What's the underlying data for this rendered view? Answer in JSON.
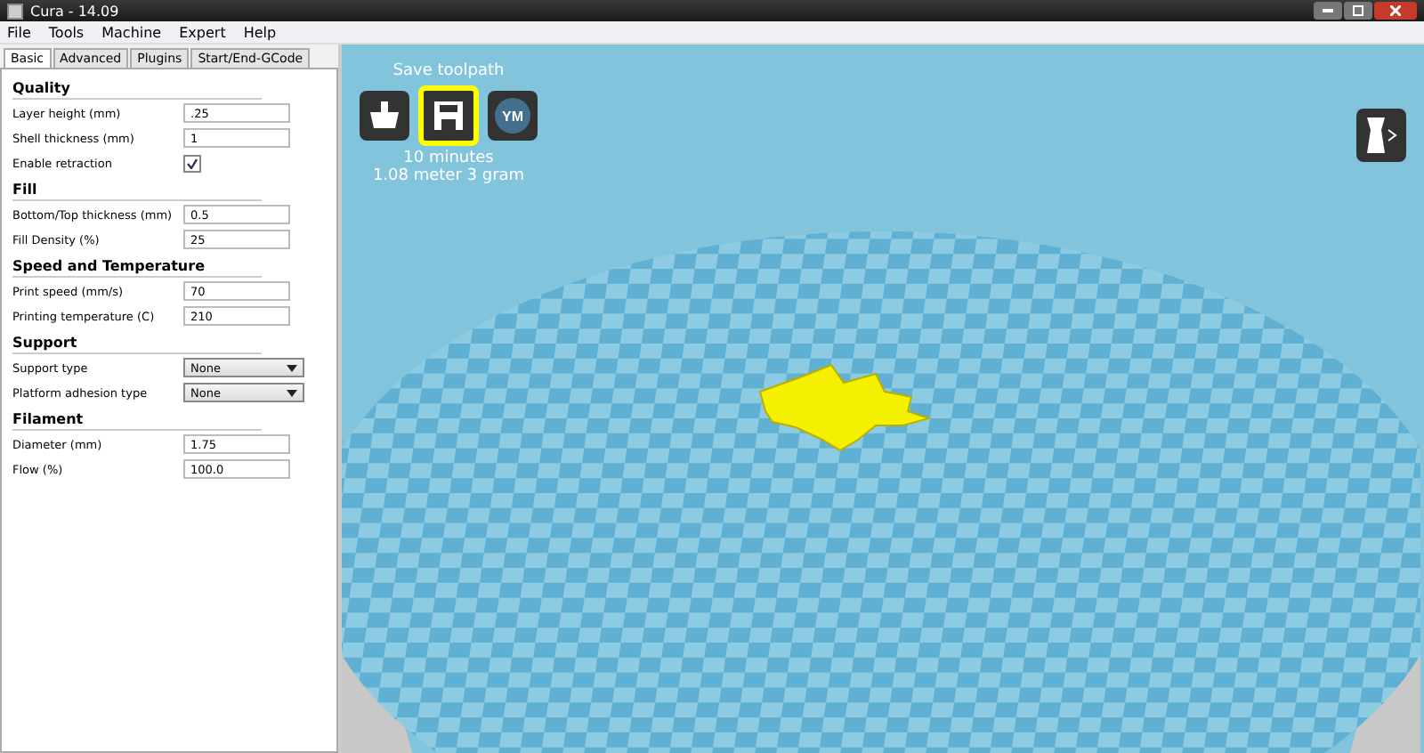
{
  "window": {
    "title": "Cura - 14.09"
  },
  "menu": [
    "File",
    "Tools",
    "Machine",
    "Expert",
    "Help"
  ],
  "tabs": [
    {
      "label": "Basic",
      "selected": true
    },
    {
      "label": "Advanced",
      "selected": false
    },
    {
      "label": "Plugins",
      "selected": false
    },
    {
      "label": "Start/End-GCode",
      "selected": false
    }
  ],
  "sections": [
    {
      "title": "Quality",
      "fields": [
        {
          "kind": "text",
          "label": "Layer height (mm)",
          "value": ".25"
        },
        {
          "kind": "text",
          "label": "Shell thickness (mm)",
          "value": "1"
        },
        {
          "kind": "checkbox",
          "label": "Enable retraction",
          "checked": true
        }
      ]
    },
    {
      "title": "Fill",
      "fields": [
        {
          "kind": "text",
          "label": "Bottom/Top thickness (mm)",
          "value": "0.5"
        },
        {
          "kind": "text",
          "label": "Fill Density (%)",
          "value": "25"
        }
      ]
    },
    {
      "title": "Speed and Temperature",
      "fields": [
        {
          "kind": "text",
          "label": "Print speed (mm/s)",
          "value": "70"
        },
        {
          "kind": "text",
          "label": "Printing temperature (C)",
          "value": "210"
        }
      ]
    },
    {
      "title": "Support",
      "fields": [
        {
          "kind": "select",
          "label": "Support type",
          "value": "None"
        },
        {
          "kind": "select",
          "label": "Platform adhesion type",
          "value": "None"
        }
      ]
    },
    {
      "title": "Filament",
      "fields": [
        {
          "kind": "text",
          "label": "Diameter (mm)",
          "value": "1.75"
        },
        {
          "kind": "text",
          "label": "Flow (%)",
          "value": "100.0"
        }
      ]
    }
  ],
  "toolbar": {
    "tooltip": "Save toolpath",
    "buttons": [
      {
        "kind": "load",
        "highlighted": false
      },
      {
        "kind": "save",
        "highlighted": true
      },
      {
        "kind": "ym",
        "label": "YM",
        "highlighted": false
      }
    ],
    "print_info": [
      "10 minutes",
      "1.08 meter 3 gram"
    ]
  }
}
